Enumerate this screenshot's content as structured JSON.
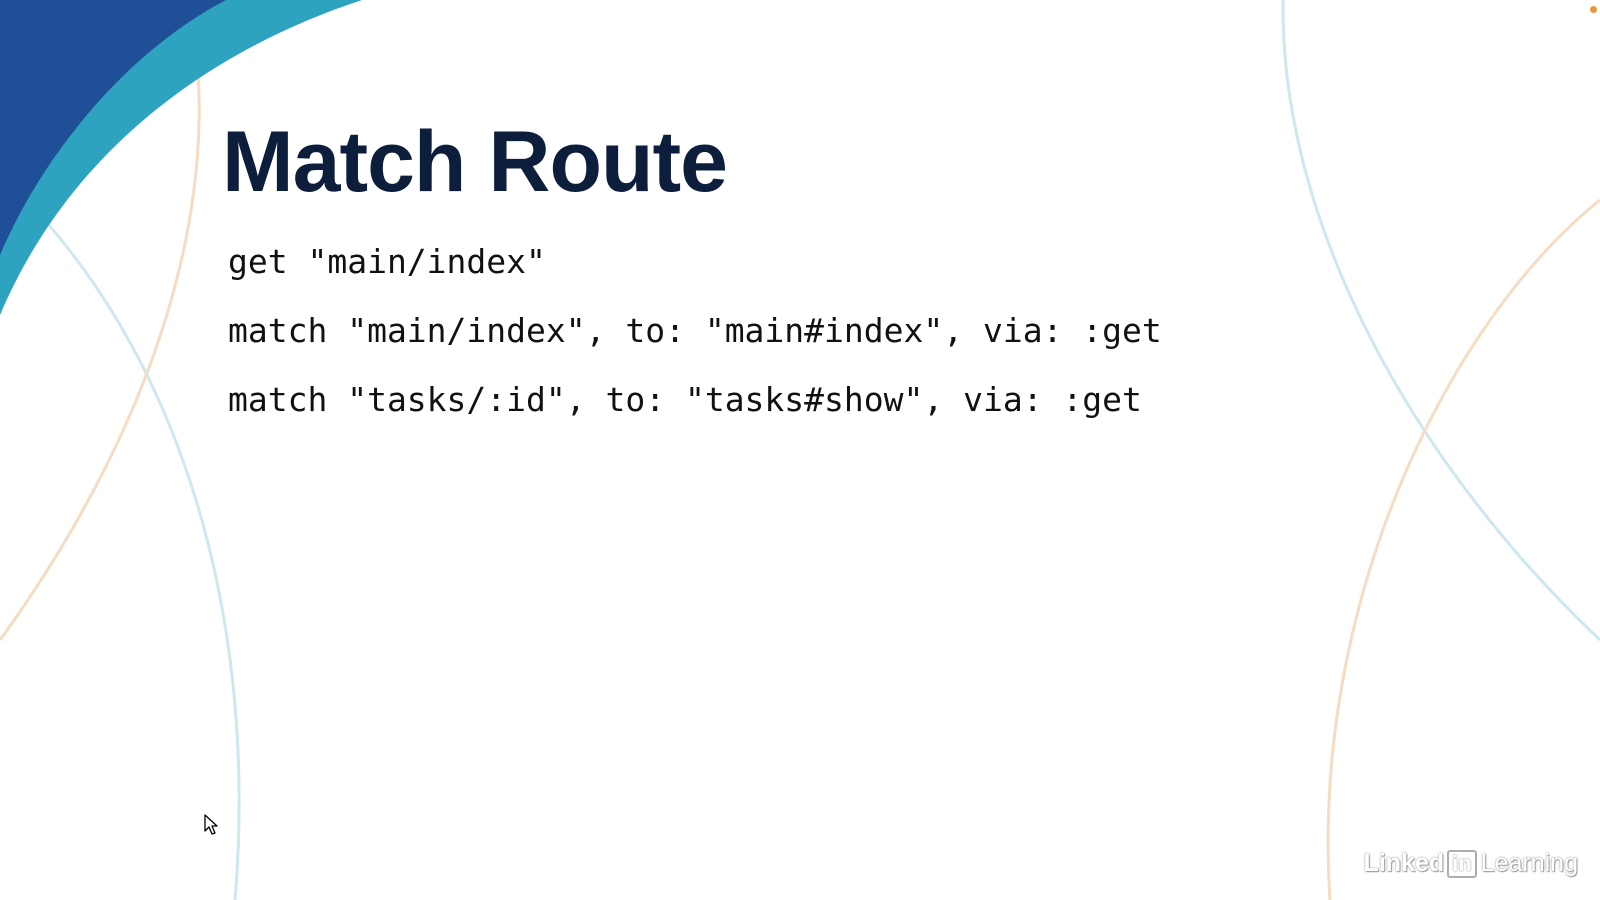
{
  "slide": {
    "title": "Match Route",
    "code_lines": [
      "get \"main/index\"",
      "match \"main/index\", to: \"main#index\", via: :get",
      "match \"tasks/:id\", to: \"tasks#show\", via: :get"
    ]
  },
  "watermark": {
    "brand_left": "Linked",
    "brand_box": "in",
    "brand_right": "Learning"
  },
  "colors": {
    "title": "#0d1e3d",
    "corner_dark_blue": "#1f4f96",
    "corner_teal": "#2ea3bf",
    "arc_teal": "#cde9ee",
    "arc_orange": "#f6dcc2"
  },
  "icons": {
    "cursor": "mouse-pointer-icon"
  }
}
